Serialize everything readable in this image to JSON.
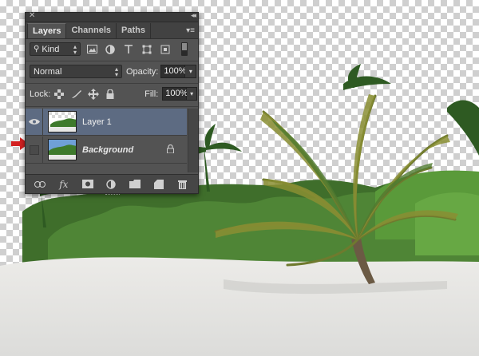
{
  "panel": {
    "tabs": [
      "Layers",
      "Channels",
      "Paths"
    ],
    "active_tab": "Layers",
    "filter": {
      "label": "Kind"
    },
    "blend_mode": "Normal",
    "opacity_label": "Opacity:",
    "opacity_value": "100%",
    "lock_label": "Lock:",
    "fill_label": "Fill:",
    "fill_value": "100%",
    "layers": [
      {
        "name": "Layer 1",
        "visible": true,
        "selected": true,
        "locked": false
      },
      {
        "name": "Background",
        "visible": false,
        "selected": false,
        "locked": true
      }
    ]
  },
  "icons": {
    "close": "close-icon",
    "collapse": "double-chevron-icon",
    "panel_menu": "panel-menu-icon",
    "filters": [
      "image-filter-icon",
      "adjustment-filter-icon",
      "type-filter-icon",
      "shape-filter-icon",
      "smart-object-filter-icon"
    ],
    "filter_toggle": "filter-toggle-icon",
    "locks": [
      "lock-transparent-pixels-icon",
      "lock-image-pixels-icon",
      "lock-position-icon",
      "lock-all-icon"
    ],
    "bottom": [
      "link-layers-icon",
      "fx-icon",
      "add-mask-icon",
      "adjustment-layer-icon",
      "new-group-icon",
      "new-layer-icon",
      "trash-icon"
    ]
  },
  "colors": {
    "panel_bg": "#535353",
    "selected_layer": "#5d6b82",
    "arrow": "#d32020"
  }
}
